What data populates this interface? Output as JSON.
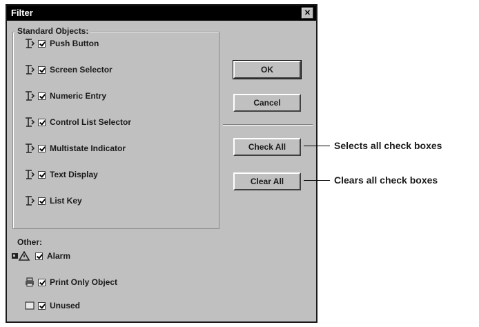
{
  "dialog": {
    "title": "Filter",
    "close_label": "✕",
    "standard_group_label": "Standard Objects:",
    "other_group_label": "Other:",
    "standard_items": [
      {
        "label": "Push Button",
        "checked": true,
        "icon": "object-icon"
      },
      {
        "label": "Screen Selector",
        "checked": true,
        "icon": "object-icon"
      },
      {
        "label": "Numeric Entry",
        "checked": true,
        "icon": "object-icon"
      },
      {
        "label": "Control List Selector",
        "checked": true,
        "icon": "object-icon"
      },
      {
        "label": "Multistate Indicator",
        "checked": true,
        "icon": "object-icon"
      },
      {
        "label": "Text Display",
        "checked": true,
        "icon": "object-icon"
      },
      {
        "label": "List Key",
        "checked": true,
        "icon": "object-icon"
      }
    ],
    "other_items": [
      {
        "label": "Alarm",
        "checked": true,
        "icon": "alarm-icon"
      },
      {
        "label": "Print Only Object",
        "checked": true,
        "icon": "printer-icon"
      },
      {
        "label": "Unused",
        "checked": true,
        "icon": "unused-box-icon"
      }
    ],
    "buttons": {
      "ok": "OK",
      "cancel": "Cancel",
      "check_all": "Check All",
      "clear_all": "Clear All"
    }
  },
  "callouts": {
    "check_all": "Selects all check boxes",
    "clear_all": "Clears all check boxes"
  }
}
